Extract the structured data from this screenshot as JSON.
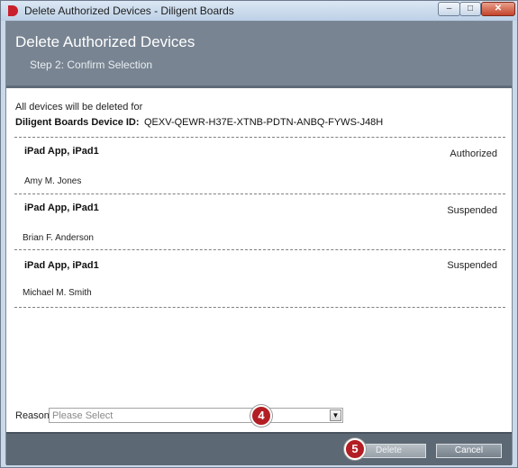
{
  "window": {
    "title": "Delete Authorized Devices - Diligent Boards"
  },
  "header": {
    "title": "Delete Authorized Devices",
    "step": "Step 2: Confirm Selection"
  },
  "body": {
    "intro": "All devices will be deleted for",
    "device_id_label": "Diligent Boards Device ID:",
    "device_id_value": "QEXV-QEWR-H37E-XTNB-PDTN-ANBQ-FYWS-J48H"
  },
  "devices": [
    {
      "name": "iPad App, iPad1",
      "user": "Amy M. Jones",
      "status": "Authorized"
    },
    {
      "name": "iPad App, iPad1",
      "user": "Brian F. Anderson",
      "status": "Suspended"
    },
    {
      "name": "iPad App, iPad1",
      "user": "Michael M. Smith",
      "status": "Suspended"
    }
  ],
  "reason": {
    "label": "Reason",
    "placeholder": "Please Select"
  },
  "callouts": {
    "reason_step": "4",
    "delete_step": "5"
  },
  "footer": {
    "delete_label": "Delete",
    "cancel_label": "Cancel"
  },
  "colors": {
    "header_bg": "#788492",
    "footer_bg": "#5c6874",
    "callout": "#b21e23",
    "app_icon": "#c8202c"
  }
}
